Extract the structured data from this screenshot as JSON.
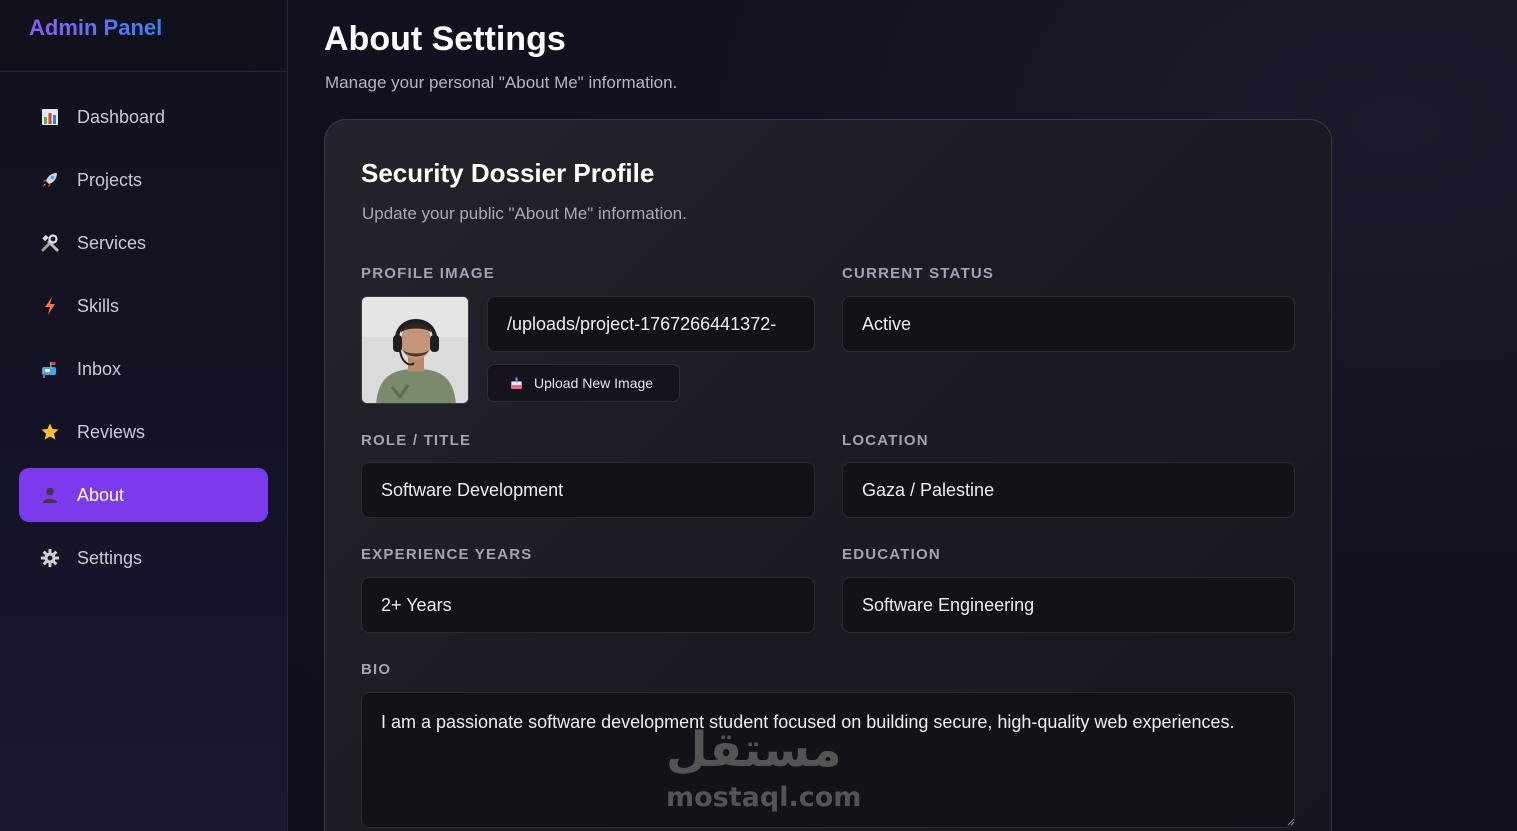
{
  "sidebar": {
    "brand": "Admin Panel",
    "items": [
      {
        "label": "Dashboard",
        "icon": "chart-icon"
      },
      {
        "label": "Projects",
        "icon": "rocket-icon"
      },
      {
        "label": "Services",
        "icon": "tools-icon"
      },
      {
        "label": "Skills",
        "icon": "lightning-icon"
      },
      {
        "label": "Inbox",
        "icon": "mailbox-icon"
      },
      {
        "label": "Reviews",
        "icon": "star-icon"
      },
      {
        "label": "About",
        "icon": "user-icon",
        "active": true
      },
      {
        "label": "Settings",
        "icon": "gear-icon"
      }
    ]
  },
  "header": {
    "title": "About Settings",
    "subtitle": "Manage your personal \"About Me\" information."
  },
  "card": {
    "title": "Security Dossier Profile",
    "subtitle": "Update your public \"About Me\" information."
  },
  "form": {
    "profile_image_label": "PROFILE IMAGE",
    "profile_image_path": "/uploads/project-1767266441372-",
    "upload_button": "Upload New Image",
    "status_label": "CURRENT STATUS",
    "status_value": "Active",
    "role_label": "ROLE / TITLE",
    "role_value": "Software Development",
    "location_label": "LOCATION",
    "location_value": "Gaza / Palestine",
    "experience_label": "EXPERIENCE YEARS",
    "experience_value": "2+ Years",
    "education_label": "EDUCATION",
    "education_value": "Software Engineering",
    "bio_label": "BIO",
    "bio_value": "I am a passionate software development student focused on building secure, high-quality web experiences."
  },
  "watermark": {
    "arabic": "مستقل",
    "latin": "mostaql.com"
  },
  "colors": {
    "accent": "#7c3aed",
    "brand_gradient_start": "#8b5cf6",
    "brand_gradient_end": "#3b82f6"
  }
}
